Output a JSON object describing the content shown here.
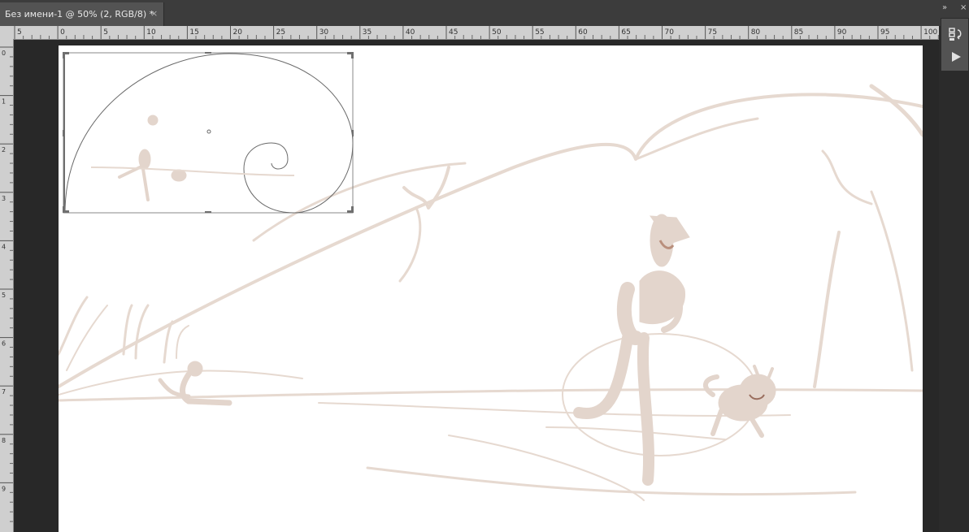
{
  "tab": {
    "title": "Без имени-1 @ 50% (2, RGB/8) *",
    "close_glyph": "×",
    "close_icon": "close-icon"
  },
  "rulers": {
    "top_labels": [
      "5",
      "0",
      "5",
      "10",
      "15",
      "20",
      "25",
      "30",
      "35",
      "40",
      "45",
      "50",
      "55",
      "60",
      "65",
      "70",
      "75",
      "80",
      "85",
      "90",
      "95",
      "100"
    ],
    "left_labels": [
      "0",
      "1",
      "2",
      "3",
      "4",
      "5",
      "6",
      "7",
      "8",
      "9"
    ]
  },
  "panel": {
    "collapse_glyph": "»",
    "close_glyph": "×",
    "history_icon": "history-icon",
    "actions_icon": "play-actions-icon"
  },
  "colors": {
    "ui_dark": "#2b2b2b",
    "tab_active": "#535353",
    "ruler": "#cfcfcf",
    "canvas": "#ffffff",
    "sketch": "#e3d5cc",
    "sketch_dark": "#d9c7bb",
    "guide": "#555555"
  },
  "artwork": {
    "description_icon": "sketch-artwork",
    "overlay": "golden-spiral-crop-overlay"
  }
}
